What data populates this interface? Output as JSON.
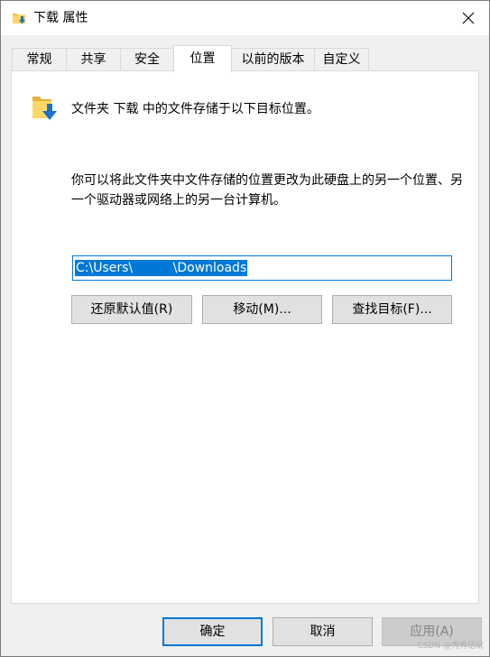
{
  "window": {
    "title": "下载 属性",
    "title_icon": "folder-download-icon",
    "close_icon": "close-icon"
  },
  "tabs": [
    {
      "label": "常规",
      "active": false
    },
    {
      "label": "共享",
      "active": false
    },
    {
      "label": "安全",
      "active": false
    },
    {
      "label": "位置",
      "active": true
    },
    {
      "label": "以前的版本",
      "active": false
    },
    {
      "label": "自定义",
      "active": false
    }
  ],
  "location": {
    "folder_icon": "folder-download-icon",
    "intro": "文件夹 下载 中的文件存储于以下目标位置。",
    "description": "你可以将此文件夹中文件存储的位置更改为此硬盘上的另一个位置、另一个驱动器或网络上的另一台计算机。",
    "path_value": "C:\\Users\\          \\Downloads",
    "buttons": {
      "restore": "还原默认值(R)",
      "move": "移动(M)...",
      "find_target": "查找目标(F)..."
    }
  },
  "footer": {
    "ok": "确定",
    "cancel": "取消",
    "apply": "应用(A)"
  },
  "watermark": "CSDN @秀秀结玩",
  "colors": {
    "accent": "#0078d7",
    "button_bg": "#e1e1e1",
    "panel_bg": "#ffffff",
    "window_bg": "#f0f0f0",
    "disabled_text": "#838383"
  }
}
